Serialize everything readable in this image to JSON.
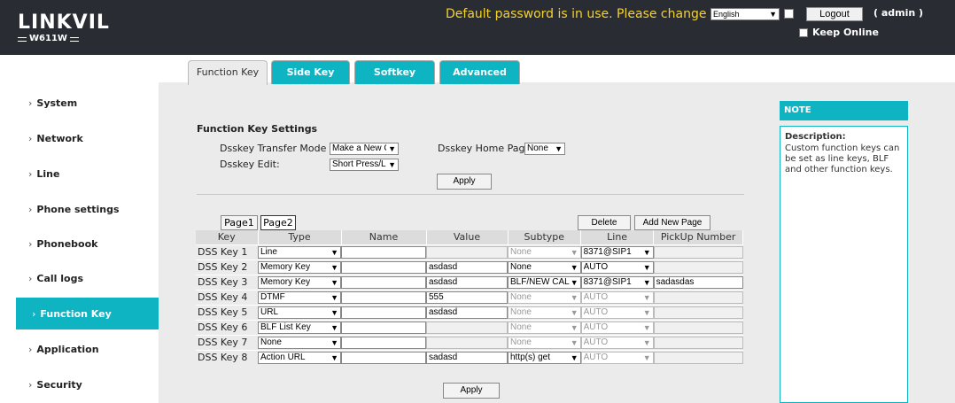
{
  "header": {
    "logo": "LINKVIL",
    "model": "W611W",
    "warning": "Default password is in use. Please change",
    "language": "English",
    "logout_label": "Logout",
    "user": "( admin )",
    "keep_online": "Keep Online"
  },
  "sidebar": {
    "items": [
      {
        "label": "System"
      },
      {
        "label": "Network"
      },
      {
        "label": "Line"
      },
      {
        "label": "Phone settings"
      },
      {
        "label": "Phonebook"
      },
      {
        "label": "Call logs"
      },
      {
        "label": "Function Key",
        "active": true
      },
      {
        "label": "Application"
      },
      {
        "label": "Security"
      }
    ]
  },
  "tabs": [
    {
      "label": "Function Key",
      "active": true
    },
    {
      "label": "Side Key"
    },
    {
      "label": "Softkey"
    },
    {
      "label": "Advanced"
    }
  ],
  "settings": {
    "title": "Function Key Settings",
    "transfer_mode_label": "Dsskey Transfer Mode",
    "transfer_mode_value": "Make a New C",
    "home_page_label": "Dsskey Home Page:",
    "home_page_value": "None",
    "edit_label": "Dsskey Edit:",
    "edit_value": "Short Press/Lo",
    "apply_label": "Apply"
  },
  "pages": {
    "page1": "Page1",
    "page2": "Page2",
    "delete_label": "Delete",
    "add_label": "Add New Page"
  },
  "table": {
    "columns": [
      "Key",
      "Type",
      "Name",
      "Value",
      "Subtype",
      "Line",
      "PickUp Number"
    ],
    "rows": [
      {
        "key": "DSS Key 1",
        "type": "Line",
        "name": "",
        "value": "",
        "value_disabled": true,
        "subtype": "None",
        "subtype_disabled": true,
        "line": "8371@SIP1",
        "line_disabled": false,
        "pickup": "",
        "pickup_disabled": true
      },
      {
        "key": "DSS Key 2",
        "type": "Memory Key",
        "name": "",
        "value": "asdasd",
        "value_disabled": false,
        "subtype": "None",
        "subtype_disabled": false,
        "line": "AUTO",
        "line_disabled": false,
        "pickup": "",
        "pickup_disabled": true
      },
      {
        "key": "DSS Key 3",
        "type": "Memory Key",
        "name": "",
        "value": "asdasd",
        "value_disabled": false,
        "subtype": "BLF/NEW CAL",
        "subtype_disabled": false,
        "line": "8371@SIP1",
        "line_disabled": false,
        "pickup": "sadasdas",
        "pickup_disabled": false
      },
      {
        "key": "DSS Key 4",
        "type": "DTMF",
        "name": "",
        "value": "555",
        "value_disabled": false,
        "subtype": "None",
        "subtype_disabled": true,
        "line": "AUTO",
        "line_disabled": true,
        "pickup": "",
        "pickup_disabled": true
      },
      {
        "key": "DSS Key 5",
        "type": "URL",
        "name": "",
        "value": "asdasd",
        "value_disabled": false,
        "subtype": "None",
        "subtype_disabled": true,
        "line": "AUTO",
        "line_disabled": true,
        "pickup": "",
        "pickup_disabled": true
      },
      {
        "key": "DSS Key 6",
        "type": "BLF List Key",
        "name": "",
        "value": "",
        "value_disabled": true,
        "subtype": "None",
        "subtype_disabled": true,
        "line": "AUTO",
        "line_disabled": true,
        "pickup": "",
        "pickup_disabled": true
      },
      {
        "key": "DSS Key 7",
        "type": "None",
        "name": "",
        "value": "",
        "value_disabled": true,
        "subtype": "None",
        "subtype_disabled": true,
        "line": "AUTO",
        "line_disabled": true,
        "pickup": "",
        "pickup_disabled": true
      },
      {
        "key": "DSS Key 8",
        "type": "Action URL",
        "name": "",
        "value": "sadasd",
        "value_disabled": false,
        "subtype": "http(s) get",
        "subtype_disabled": false,
        "line": "AUTO",
        "line_disabled": true,
        "pickup": "",
        "pickup_disabled": true
      }
    ],
    "apply_label": "Apply"
  },
  "note": {
    "title": "NOTE",
    "description_label": "Description:",
    "description": "Custom function keys can be set as line keys, BLF and other function keys."
  },
  "colors": {
    "accent": "#0fb4c3",
    "header_bg": "#2a2c33",
    "warning": "#f5d22a"
  }
}
